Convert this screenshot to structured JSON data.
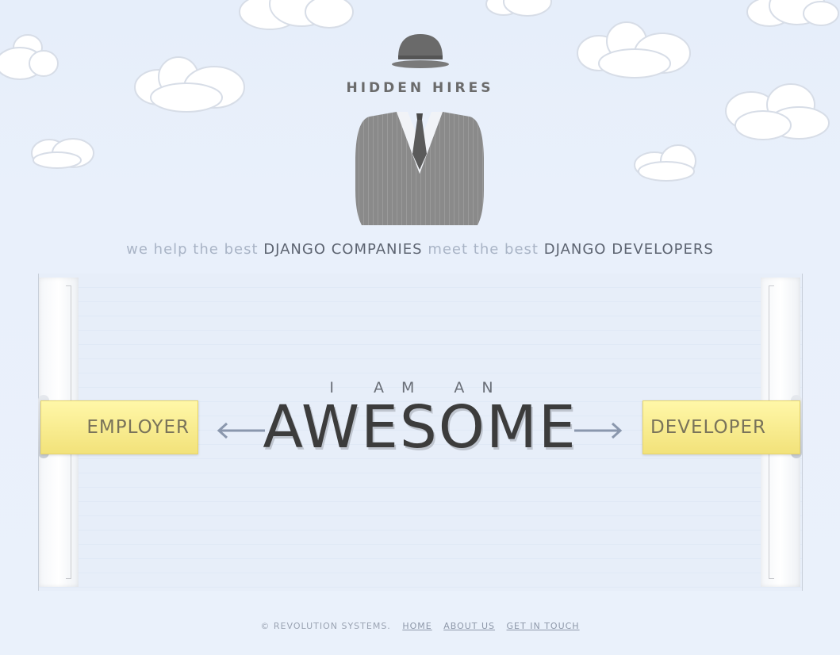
{
  "brand": {
    "name": "HIDDEN HIRES"
  },
  "tagline": {
    "p1": "we help the best",
    "p2": "DJANGO COMPANIES",
    "p3": "meet the best",
    "p4": "DJANGO DEVELOPERS"
  },
  "hero": {
    "prefix": "I AM AN",
    "headline": "AWESOME",
    "left_choice": "EMPLOYER",
    "right_choice": "DEVELOPER"
  },
  "footer": {
    "copyright": "© REVOLUTION SYSTEMS.",
    "links": [
      "HOME",
      "ABOUT US",
      "GET IN TOUCH"
    ]
  },
  "colors": {
    "sky": "#e8f0fb",
    "sign_yellow": "#f6e989",
    "headline": "#3c3c3c"
  }
}
